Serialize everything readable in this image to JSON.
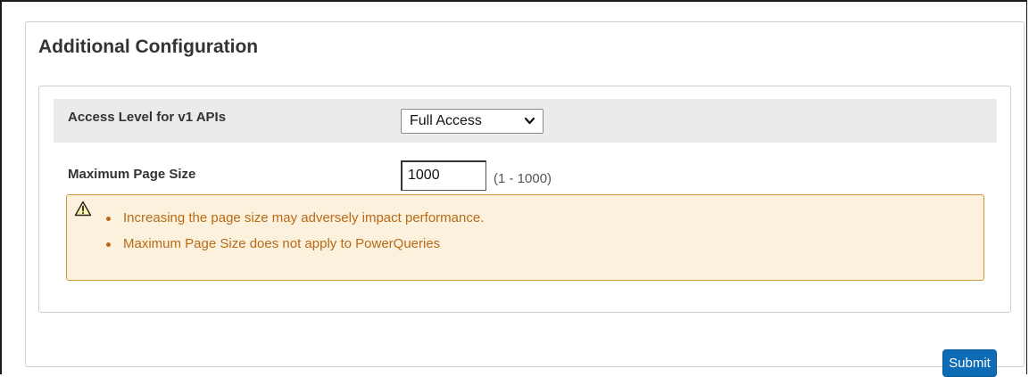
{
  "panel": {
    "title": "Additional Configuration"
  },
  "access_level": {
    "label": "Access Level for v1 APIs",
    "selected": "Full Access",
    "icon": "chevron-down-icon"
  },
  "page_size": {
    "label": "Maximum Page Size",
    "value": "1000",
    "range_hint": "(1 - 1000)"
  },
  "warning": {
    "icon": "warning-icon",
    "items": [
      "Increasing the page size may adversely impact performance.",
      "Maximum Page Size does not apply to PowerQueries"
    ],
    "text_color": "#b96a17",
    "background": "#fcf1dc",
    "border_color": "#c79a3d"
  },
  "submit": {
    "label": "Submit",
    "color": "#0d6cb5"
  }
}
